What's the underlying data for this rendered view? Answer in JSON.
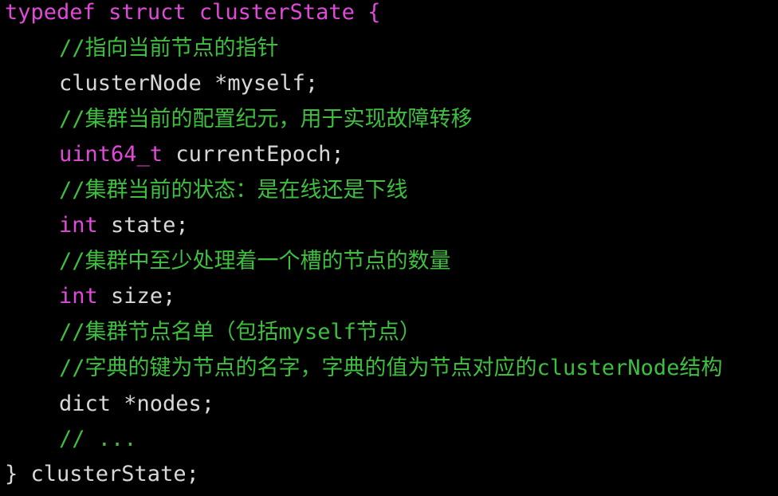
{
  "colors": {
    "background": "#000000",
    "keyword": "#e04ad9",
    "plain": "#d8d8d8",
    "comment": "#3fbf3f"
  },
  "code": {
    "l1": {
      "kw1": "typedef",
      "kw2": "struct",
      "name": "clusterState {"
    },
    "l2": {
      "comment": "//指向当前节点的指针"
    },
    "l3": {
      "code": "clusterNode *myself;"
    },
    "l4": {
      "comment": "//集群当前的配置纪元，用于实现故障转移"
    },
    "l5": {
      "type": "uint64_t",
      "code": "currentEpoch;"
    },
    "l6": {
      "comment": "//集群当前的状态：是在线还是下线"
    },
    "l7": {
      "type": "int",
      "code": "state;"
    },
    "l8": {
      "comment": "//集群中至少处理着一个槽的节点的数量"
    },
    "l9": {
      "type": "int",
      "code": "size;"
    },
    "l10": {
      "comment": "//集群节点名单（包括myself节点）"
    },
    "l11": {
      "comment": "//字典的键为节点的名字，字典的值为节点对应的clusterNode结构"
    },
    "l12": {
      "code": "dict *nodes;"
    },
    "l13": {
      "comment": "// ..."
    },
    "l14": {
      "code": "} clusterState;"
    }
  }
}
